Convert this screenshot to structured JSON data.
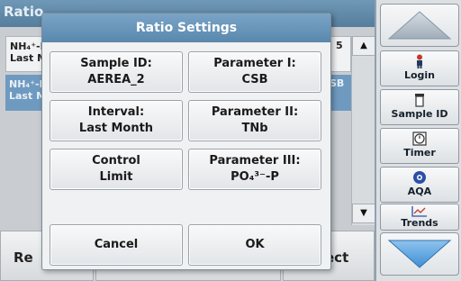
{
  "background": {
    "title": "Ratio",
    "rows": [
      {
        "line1": "NH₄⁺-I",
        "line2": "Last M",
        "right": "5"
      },
      {
        "line1": "NH₄⁺-I",
        "line2": "Last M",
        "right": "SB"
      }
    ],
    "bottom_left": "Re",
    "bottom_right": "ect"
  },
  "side_panel": {
    "login": "Login",
    "sample_id": "Sample ID",
    "timer": "Timer",
    "aqa": "AQA",
    "trends": "Trends"
  },
  "dialog": {
    "title": "Ratio Settings",
    "sample_id": {
      "label": "Sample ID:",
      "value": "AEREA_2"
    },
    "parameter_1": {
      "label": "Parameter I:",
      "value": "CSB"
    },
    "interval": {
      "label": "Interval:",
      "value": "Last Month"
    },
    "parameter_2": {
      "label": "Parameter II:",
      "value": "TNb"
    },
    "control_limit": {
      "line1": "Control",
      "line2": "Limit"
    },
    "parameter_3": {
      "label": "Parameter III:",
      "value": "PO₄³⁻-P"
    },
    "cancel": "Cancel",
    "ok": "OK"
  },
  "colors": {
    "title_bar": "#6a95b9",
    "selected_row": "#6f9ac0"
  }
}
